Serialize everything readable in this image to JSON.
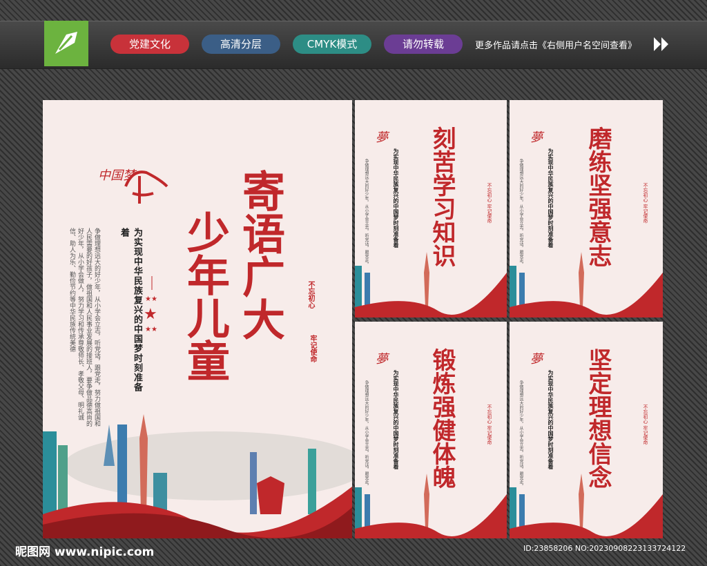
{
  "header": {
    "tags": [
      {
        "label": "党建文化",
        "color": "#c8323a"
      },
      {
        "label": "高清分层",
        "color": "#3b5e86"
      },
      {
        "label": "CMYK模式",
        "color": "#2d8d85"
      },
      {
        "label": "请勿转载",
        "color": "#6b3d94"
      }
    ],
    "more_text": "更多作品请点击《右侧用户名空间查看》"
  },
  "main_poster": {
    "title_line1": "寄语广大",
    "title_line2": "少年儿童",
    "logo_text": "中国梦",
    "subtitle": "为实现中华民族复兴的中国梦时刻准备着",
    "seal1": "不忘初心",
    "seal2": "牢记使命",
    "body": [
      "争做理想远大的好少年，从小学会立志，听党话，跟党走，",
      "努力做祖国和人民需要的好孩子，做祖国和人民事业发展的接班",
      "人，要争做品德高尚的好少年，从小学会做人，努力学习和",
      "传承尊敬师长、孝敬父母、明礼诚信、助人为乐、",
      "勤俭节约等中华民族传统美德"
    ]
  },
  "small_posters": [
    {
      "title": "刻苦学习知识"
    },
    {
      "title": "磨练坚强意志"
    },
    {
      "title": "锻炼强健体魄"
    },
    {
      "title": "坚定理想信念"
    }
  ],
  "small_common": {
    "subtitle": "为实现中华民族复兴的中国梦时刻准备着",
    "seal": "不忘初心 牢记使命"
  },
  "footer": {
    "site": "昵图网 www.nipic.com",
    "id": "ID:23858206 NO:20230908223133724122"
  }
}
